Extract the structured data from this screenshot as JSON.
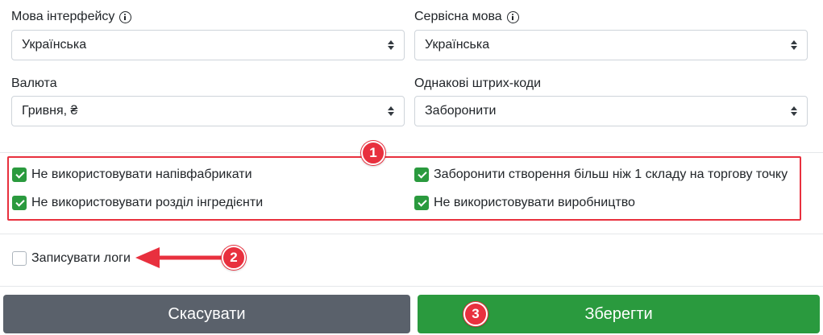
{
  "form": {
    "interface_language": {
      "label": "Мова інтерфейсу",
      "value": "Українська"
    },
    "service_language": {
      "label": "Сервісна мова",
      "value": "Українська"
    },
    "currency": {
      "label": "Валюта",
      "value": "Гривня, ₴"
    },
    "duplicate_barcodes": {
      "label": "Однакові штрих-коди",
      "value": "Заборонити"
    }
  },
  "options": {
    "no_semi_finished": {
      "label": "Не використовувати напівфабрикати",
      "checked": true
    },
    "no_ingredients_section": {
      "label": "Не використовувати розділ інгредієнти",
      "checked": true
    },
    "single_warehouse": {
      "label": "Заборонити створення більш ніж 1 складу на торгову точку",
      "checked": true
    },
    "no_production": {
      "label": "Не використовувати виробництво",
      "checked": true
    },
    "write_logs": {
      "label": "Записувати логи",
      "checked": false
    }
  },
  "buttons": {
    "cancel": "Скасувати",
    "save": "Зберегти"
  },
  "annotations": {
    "badge1": "1",
    "badge2": "2",
    "badge3": "3"
  },
  "colors": {
    "accent_green": "#2a9a3e",
    "annotation_red": "#e8303e",
    "cancel_gray": "#5a616b"
  }
}
